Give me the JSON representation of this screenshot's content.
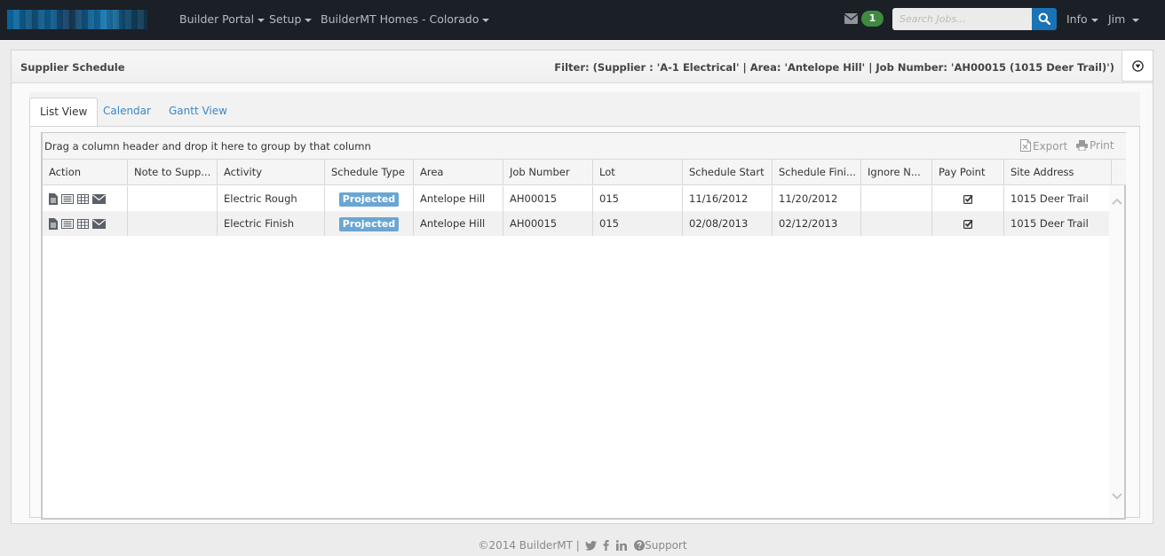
{
  "navbar": {
    "brand_alt": "Company logo (pixelated)",
    "menus": [
      {
        "label": "Builder Portal"
      },
      {
        "label": "Setup"
      },
      {
        "label": "BuilderMT Homes - Colorado"
      }
    ],
    "messages_count": "1",
    "search": {
      "placeholder": "Search Jobs...",
      "value": ""
    },
    "info_label": "Info",
    "user_label": "Jim"
  },
  "panel": {
    "title": "Supplier Schedule",
    "filter": "Filter: (Supplier : 'A-1 Electrical' | Area: 'Antelope Hill' | Job Number: 'AH00015 (1015 Deer Trail)')"
  },
  "tabs": [
    {
      "label": "List View",
      "active": true
    },
    {
      "label": "Calendar",
      "active": false
    },
    {
      "label": "Gantt View",
      "active": false
    }
  ],
  "grid": {
    "group_hint": "Drag a column header and drop it here to group by that column",
    "export_label": "Export",
    "print_label": "Print",
    "columns": [
      "Action",
      "Note to Supp...",
      "Activity",
      "Schedule Type",
      "Area",
      "Job Number",
      "Lot",
      "Schedule Start",
      "Schedule Fini...",
      "Ignore N...",
      "Pay Point",
      "Site Address"
    ],
    "action_icons": [
      "document-icon",
      "list-icon",
      "grid-icon",
      "envelope-icon"
    ],
    "rows": [
      {
        "note": "",
        "activity": "Electric Rough",
        "schedule_type": "Projected",
        "area": "Antelope Hill",
        "job_number": "AH00015",
        "lot": "015",
        "schedule_start": "11/16/2012",
        "schedule_finish": "11/20/2012",
        "ignore": "",
        "pay_point": true,
        "site_address": "1015 Deer Trail"
      },
      {
        "note": "",
        "activity": "Electric Finish",
        "schedule_type": "Projected",
        "area": "Antelope Hill",
        "job_number": "AH00015",
        "lot": "015",
        "schedule_start": "02/08/2013",
        "schedule_finish": "02/12/2013",
        "ignore": "",
        "pay_point": true,
        "site_address": "1015 Deer Trail"
      }
    ]
  },
  "footer": {
    "copyright": "©2014 BuilderMT |",
    "support_label": "Support"
  },
  "colors": {
    "navbar_bg": "#1b1f26",
    "accent_blue": "#1a73b5",
    "badge_green": "#3f8a3f",
    "projected_badge": "#6aa6d3",
    "link_blue": "#3a87c8"
  }
}
